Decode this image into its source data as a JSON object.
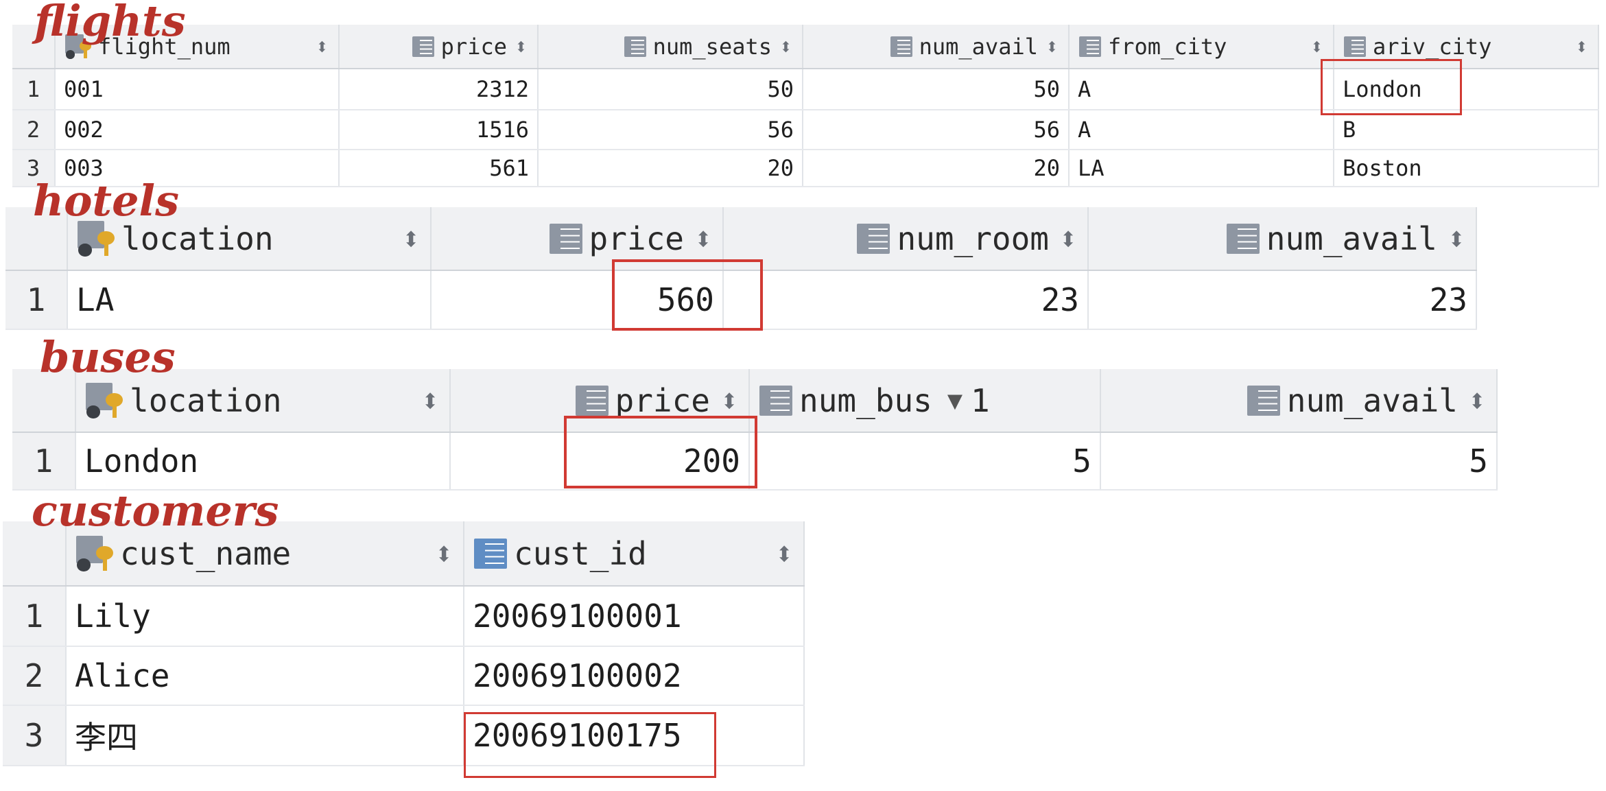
{
  "labels": {
    "flights": "flights",
    "hotels": "hotels",
    "buses": "buses",
    "customers": "customers"
  },
  "icons": {
    "key_column": "primary-key-column-icon",
    "column": "column-icon",
    "sort": "sort-arrows-icon"
  },
  "colors": {
    "annotation": "#b8322a",
    "highlight_box": "#d13a33",
    "header_bg": "#f0f1f3"
  },
  "flights": {
    "columns": [
      "flight_num",
      "price",
      "num_seats",
      "num_avail",
      "from_city",
      "ariv_city"
    ],
    "rows": [
      {
        "n": "1",
        "flight_num": "001",
        "price": "2312",
        "num_seats": "50",
        "num_avail": "50",
        "from_city": "A",
        "ariv_city": "London"
      },
      {
        "n": "2",
        "flight_num": "002",
        "price": "1516",
        "num_seats": "56",
        "num_avail": "56",
        "from_city": "A",
        "ariv_city": "B"
      },
      {
        "n": "3",
        "flight_num": "003",
        "price": "561",
        "num_seats": "20",
        "num_avail": "20",
        "from_city": "LA",
        "ariv_city": "Boston"
      }
    ]
  },
  "hotels": {
    "columns": [
      "location",
      "price",
      "num_room",
      "num_avail"
    ],
    "rows": [
      {
        "n": "1",
        "location": "LA",
        "price": "560",
        "num_room": "23",
        "num_avail": "23"
      }
    ]
  },
  "buses": {
    "columns": [
      "location",
      "price",
      "num_bus",
      "num_avail"
    ],
    "sort_marker": {
      "column": "num_bus",
      "direction": "descending",
      "order": "1"
    },
    "rows": [
      {
        "n": "1",
        "location": "London",
        "price": "200",
        "num_bus": "5",
        "num_avail": "5"
      }
    ]
  },
  "customers": {
    "columns": [
      "cust_name",
      "cust_id"
    ],
    "rows": [
      {
        "n": "1",
        "cust_name": "Lily",
        "cust_id": "20069100001"
      },
      {
        "n": "2",
        "cust_name": "Alice",
        "cust_id": "20069100002"
      },
      {
        "n": "3",
        "cust_name": "李四",
        "cust_id": "20069100175"
      }
    ]
  }
}
